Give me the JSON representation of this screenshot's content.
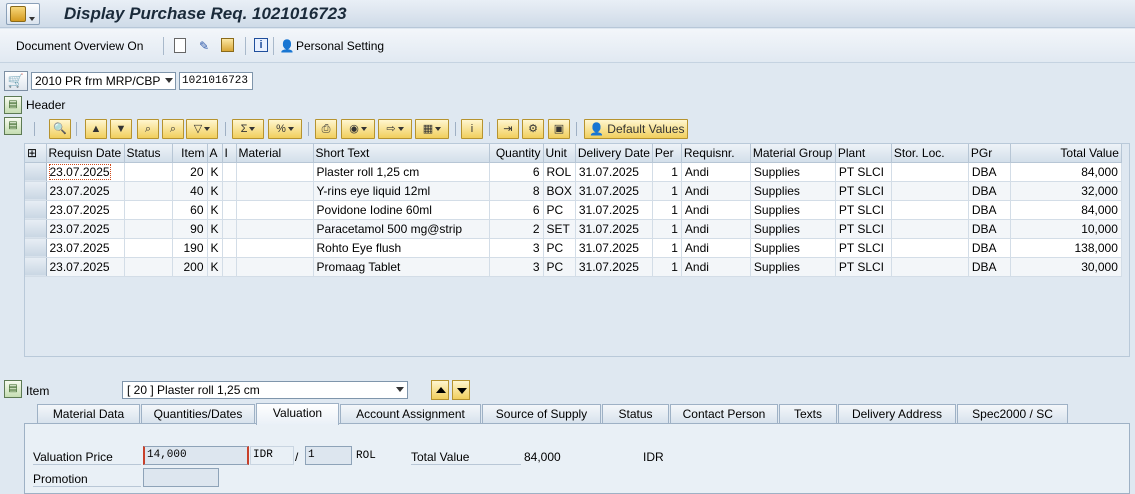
{
  "window": {
    "title": "Display Purchase Req. 1021016723"
  },
  "toolbar": {
    "doc_overview": "Document Overview On",
    "personal_setting": "Personal Setting"
  },
  "document": {
    "type": "2010 PR frm MRP/CBP",
    "number": "1021016723"
  },
  "header": {
    "label": "Header"
  },
  "grid_toolbar": {
    "default_values": "Default Values"
  },
  "table": {
    "columns": [
      "Requisn Date",
      "Status",
      "Item",
      "A",
      "I",
      "Material",
      "Short Text",
      "Quantity",
      "Unit",
      "Delivery Date",
      "Per",
      "Requisnr.",
      "Material Group",
      "Plant",
      "Stor. Loc.",
      "PGr",
      "Total Value"
    ],
    "rows": [
      [
        "23.07.2025",
        "",
        "20",
        "K",
        "",
        "",
        "Plaster roll 1,25 cm",
        "6",
        "ROL",
        "31.07.2025",
        "1",
        "Andi",
        "Supplies",
        "PT SLCI",
        "",
        "DBA",
        "84,000"
      ],
      [
        "23.07.2025",
        "",
        "40",
        "K",
        "",
        "",
        "Y-rins eye liquid 12ml",
        "8",
        "BOX",
        "31.07.2025",
        "1",
        "Andi",
        "Supplies",
        "PT SLCI",
        "",
        "DBA",
        "32,000"
      ],
      [
        "23.07.2025",
        "",
        "60",
        "K",
        "",
        "",
        "Povidone Iodine 60ml",
        "6",
        "PC",
        "31.07.2025",
        "1",
        "Andi",
        "Supplies",
        "PT SLCI",
        "",
        "DBA",
        "84,000"
      ],
      [
        "23.07.2025",
        "",
        "90",
        "K",
        "",
        "",
        "Paracetamol 500 mg@strip",
        "2",
        "SET",
        "31.07.2025",
        "1",
        "Andi",
        "Supplies",
        "PT SLCI",
        "",
        "DBA",
        "10,000"
      ],
      [
        "23.07.2025",
        "",
        "190",
        "K",
        "",
        "",
        "Rohto Eye flush",
        "3",
        "PC",
        "31.07.2025",
        "1",
        "Andi",
        "Supplies",
        "PT SLCI",
        "",
        "DBA",
        "138,000"
      ],
      [
        "23.07.2025",
        "",
        "200",
        "K",
        "",
        "",
        "Promaag Tablet",
        "3",
        "PC",
        "31.07.2025",
        "1",
        "Andi",
        "Supplies",
        "PT SLCI",
        "",
        "DBA",
        "30,000"
      ]
    ]
  },
  "item": {
    "label": "Item",
    "selected": "[ 20 ] Plaster roll 1,25 cm"
  },
  "tabs": [
    "Material Data",
    "Quantities/Dates",
    "Valuation",
    "Account Assignment",
    "Source of Supply",
    "Status",
    "Contact Person",
    "Texts",
    "Delivery Address",
    "Spec2000 / SC"
  ],
  "valuation": {
    "price_label": "Valuation Price",
    "price": "14,000",
    "currency": "IDR",
    "slash": "/",
    "per": "1",
    "unit": "ROL",
    "total_label": "Total Value",
    "total": "84,000",
    "total_currency": "IDR",
    "promotion_label": "Promotion",
    "promotion": ""
  },
  "colors": {
    "accent_button": "#f1cf5d",
    "background": "#dfe8f1"
  }
}
